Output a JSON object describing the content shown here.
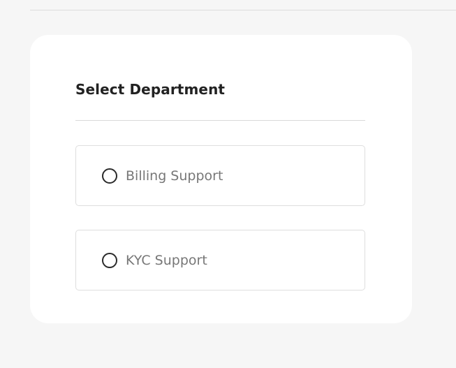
{
  "department_selector": {
    "title": "Select Department",
    "options": [
      {
        "label": "Billing Support",
        "selected": false
      },
      {
        "label": "KYC Support",
        "selected": false
      }
    ]
  }
}
